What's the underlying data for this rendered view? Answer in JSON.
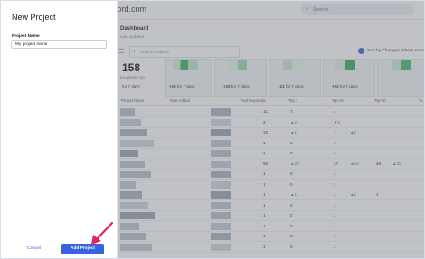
{
  "app": {
    "brand": "word.com",
    "top_search_placeholder": "Search",
    "dashboard_title": "Dashboard",
    "dashboard_subtitle": "Last updated",
    "project_search_placeholder": "Search Projects",
    "sort_label": "Sort by Changes Where sorts",
    "keywords_value": "158",
    "keywords_label": "Keywords Up",
    "stats": [
      {
        "delta": "",
        "label": "for 7 days"
      },
      {
        "delta": "+18",
        "label": "for 7 days"
      },
      {
        "delta": "+20",
        "label": "for 7 days"
      },
      {
        "delta": "+21",
        "label": "for 7 days"
      },
      {
        "delta": "+22",
        "label": "for 7 days"
      }
    ],
    "table_headers": [
      "Project Name",
      "Date Added",
      "Total Keywords",
      "Top 3",
      "Top 10",
      "Top 20",
      "To"
    ],
    "rows": [
      [
        "11",
        "7",
        "4"
      ],
      [
        "2",
        "▲2",
        "▼2"
      ],
      [
        "32",
        "▲1",
        "1",
        "▲1"
      ],
      [
        "1",
        "0",
        "1"
      ],
      [
        "1",
        "0",
        "1"
      ],
      [
        "55",
        "▲20",
        "27",
        "▲16",
        "46",
        "▲28"
      ],
      [
        "1",
        "0",
        "1"
      ],
      [
        "1",
        "0",
        "1"
      ],
      [
        "1",
        "▲1",
        "1",
        "▲1",
        "1"
      ],
      [
        "1",
        "0",
        "1"
      ],
      [
        "1",
        "0",
        "1"
      ],
      [
        "1",
        "0",
        "1"
      ],
      [
        "1",
        "0",
        "1"
      ],
      [
        "1",
        "0",
        "1"
      ]
    ]
  },
  "modal": {
    "title": "New Project",
    "field_label": "Project Name",
    "field_value": "My project name",
    "cancel_label": "Cancel",
    "submit_label": "Add Project"
  },
  "colors": {
    "accent": "#3663e0",
    "arrow": "#e0245e",
    "positive": "#2aa44f"
  }
}
